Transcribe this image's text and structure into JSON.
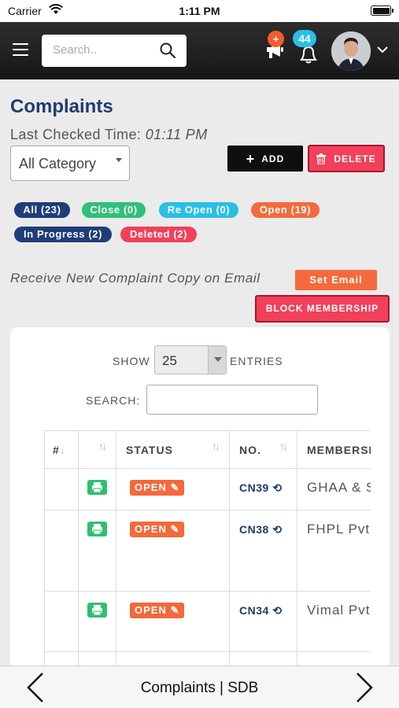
{
  "status_bar": {
    "carrier": "Carrier",
    "time": "1:11 PM"
  },
  "nav": {
    "search_placeholder": "Search..",
    "announcement_badge": "+",
    "notification_count": "44"
  },
  "page": {
    "title": "Complaints",
    "last_checked_label": "Last Checked Time:",
    "last_checked_time": "01:11 PM",
    "category_selected": "All Category",
    "add_label": "ADD",
    "delete_label": "DELETE"
  },
  "filters": [
    {
      "label": "All (23)",
      "color": "#1f3d7a"
    },
    {
      "label": "Close (0)",
      "color": "#2fc07a"
    },
    {
      "label": "Re Open (0)",
      "color": "#29bfe6"
    },
    {
      "label": "Open (19)",
      "color": "#f46a3c"
    },
    {
      "label": "In Progress (2)",
      "color": "#1f3d7a"
    },
    {
      "label": "Deleted (2)",
      "color": "#f2405a"
    }
  ],
  "email": {
    "text": "Receive New Complaint Copy on Email",
    "set_email_label": "Set Email",
    "block_label": "BLOCK MEMBERSHIP"
  },
  "table_controls": {
    "show_label": "SHOW",
    "entries_value": "25",
    "entries_label": "ENTRIES",
    "search_label": "SEARCH:"
  },
  "table": {
    "headers": [
      "#",
      "",
      "STATUS",
      "NO.",
      "MEMBERSHIP"
    ],
    "rows": [
      {
        "status": "OPEN",
        "no": "CN39",
        "member": "GHAA & S"
      },
      {
        "status": "OPEN",
        "no": "CN38",
        "member": "FHPL Pvt"
      },
      {
        "status": "OPEN",
        "no": "CN34",
        "member": "Vimal Pvt"
      }
    ]
  },
  "bottom_bar": {
    "title": "Complaints | SDB"
  }
}
